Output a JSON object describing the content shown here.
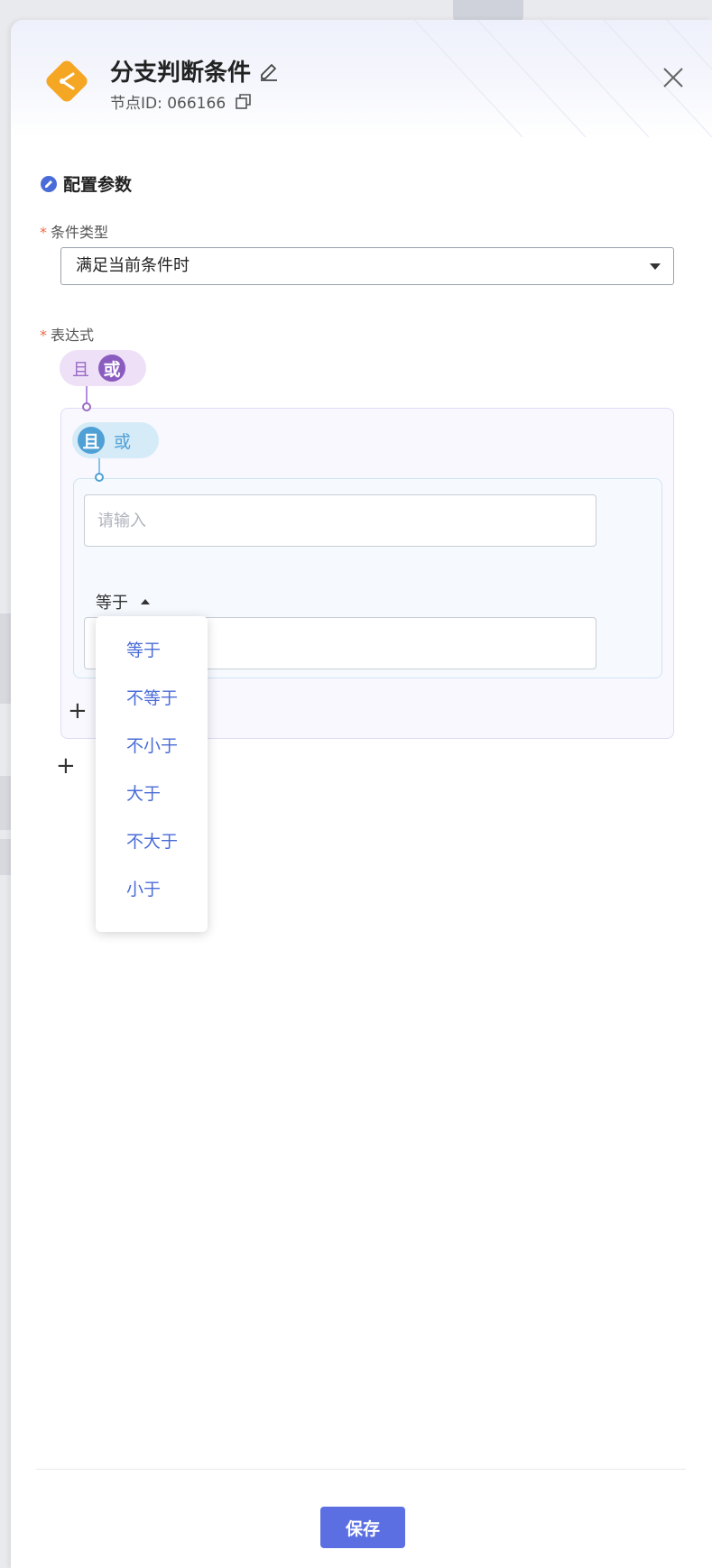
{
  "header": {
    "title": "分支判断条件",
    "node_id_label": "节点ID: 066166"
  },
  "section": {
    "title": "配置参数"
  },
  "condition_type": {
    "label": "条件类型",
    "required_mark": "*",
    "selected": "满足当前条件时"
  },
  "expression": {
    "label": "表达式",
    "required_mark": "*",
    "outer_toggle": {
      "and_label": "且",
      "or_label": "或",
      "active": "或"
    },
    "inner_toggle": {
      "and_label": "且",
      "or_label": "或",
      "active": "且"
    },
    "field_placeholder": "请输入",
    "operator": "等于",
    "add_condition_label": "",
    "add_group_label": ""
  },
  "operator_dropdown": {
    "options": [
      "等于",
      "不等于",
      "不小于",
      "大于",
      "不大于",
      "小于"
    ]
  },
  "footer": {
    "save_label": "保存"
  },
  "colors": {
    "accent": "#5b6fe2",
    "or_toggle": "#8a5cc0",
    "and_toggle": "#4fa0d5",
    "node_icon": "#f5a623",
    "required": "#f06a4a"
  }
}
